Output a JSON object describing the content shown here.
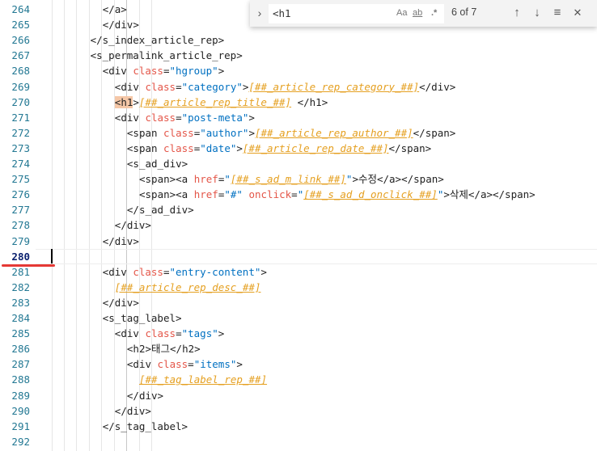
{
  "find_widget": {
    "toggle_icon": "›",
    "query": "<h1",
    "match_case_label": "Aa",
    "whole_word_label": "ab",
    "regex_label": ".*",
    "match_count": "6 of 7",
    "prev_icon": "↑",
    "next_icon": "↓",
    "selection_icon": "≡",
    "close_icon": "✕"
  },
  "editor": {
    "active_line": "280",
    "line_numbers": [
      "264",
      "265",
      "266",
      "267",
      "268",
      "269",
      "270",
      "271",
      "272",
      "273",
      "274",
      "275",
      "276",
      "277",
      "278",
      "279",
      "280",
      "281",
      "282",
      "283",
      "284",
      "285",
      "286",
      "287",
      "288",
      "289",
      "290",
      "291",
      "292"
    ],
    "lines": [
      [
        {
          "t": "</a>",
          "c": "tag"
        }
      ],
      [
        {
          "t": "</div>",
          "c": "tag"
        }
      ],
      [
        {
          "t": "</s_index_article_rep>",
          "c": "tag"
        }
      ],
      [
        {
          "t": "<s_permalink_article_rep>",
          "c": "tag"
        }
      ],
      [
        {
          "t": "<div ",
          "c": "tag"
        },
        {
          "t": "class",
          "c": "attr"
        },
        {
          "t": "=",
          "c": "tag"
        },
        {
          "t": "\"hgroup\"",
          "c": "str"
        },
        {
          "t": ">",
          "c": "tag"
        }
      ],
      [
        {
          "t": "<div ",
          "c": "tag"
        },
        {
          "t": "class",
          "c": "attr"
        },
        {
          "t": "=",
          "c": "tag"
        },
        {
          "t": "\"category\"",
          "c": "str"
        },
        {
          "t": ">",
          "c": "tag"
        },
        {
          "t": "[##_article_rep_category_##]",
          "c": "tpl"
        },
        {
          "t": "</div>",
          "c": "tag"
        }
      ],
      [
        {
          "t": "<h1",
          "c": "tag hl"
        },
        {
          "t": ">",
          "c": "tag"
        },
        {
          "t": "[##_article_rep_title_##]",
          "c": "tpl"
        },
        {
          "t": " </h1>",
          "c": "tag"
        }
      ],
      [
        {
          "t": "<div ",
          "c": "tag"
        },
        {
          "t": "class",
          "c": "attr"
        },
        {
          "t": "=",
          "c": "tag"
        },
        {
          "t": "\"post-meta\"",
          "c": "str"
        },
        {
          "t": ">",
          "c": "tag"
        }
      ],
      [
        {
          "t": "<span ",
          "c": "tag"
        },
        {
          "t": "class",
          "c": "attr"
        },
        {
          "t": "=",
          "c": "tag"
        },
        {
          "t": "\"author\"",
          "c": "str"
        },
        {
          "t": ">",
          "c": "tag"
        },
        {
          "t": "[##_article_rep_author_##]",
          "c": "tpl"
        },
        {
          "t": "</span>",
          "c": "tag"
        }
      ],
      [
        {
          "t": "<span ",
          "c": "tag"
        },
        {
          "t": "class",
          "c": "attr"
        },
        {
          "t": "=",
          "c": "tag"
        },
        {
          "t": "\"date\"",
          "c": "str"
        },
        {
          "t": ">",
          "c": "tag"
        },
        {
          "t": "[##_article_rep_date_##]",
          "c": "tpl"
        },
        {
          "t": "</span>",
          "c": "tag"
        }
      ],
      [
        {
          "t": "<s_ad_div>",
          "c": "tag"
        }
      ],
      [
        {
          "t": "<span><a ",
          "c": "tag"
        },
        {
          "t": "href",
          "c": "attr"
        },
        {
          "t": "=",
          "c": "tag"
        },
        {
          "t": "\"",
          "c": "str"
        },
        {
          "t": "[##_s_ad_m_link_##]",
          "c": "tpl"
        },
        {
          "t": "\"",
          "c": "str"
        },
        {
          "t": ">",
          "c": "tag"
        },
        {
          "t": "수정",
          "c": "tag kr"
        },
        {
          "t": "</a></span>",
          "c": "tag"
        }
      ],
      [
        {
          "t": "<span><a ",
          "c": "tag"
        },
        {
          "t": "href",
          "c": "attr"
        },
        {
          "t": "=",
          "c": "tag"
        },
        {
          "t": "\"#\" ",
          "c": "str"
        },
        {
          "t": "onclick",
          "c": "attr"
        },
        {
          "t": "=",
          "c": "tag"
        },
        {
          "t": "\"",
          "c": "str"
        },
        {
          "t": "[##_s_ad_d_onclick_##]",
          "c": "tpl"
        },
        {
          "t": "\"",
          "c": "str"
        },
        {
          "t": ">",
          "c": "tag"
        },
        {
          "t": "삭제",
          "c": "tag kr"
        },
        {
          "t": "</a></span>",
          "c": "tag"
        }
      ],
      [
        {
          "t": "</s_ad_div>",
          "c": "tag"
        }
      ],
      [
        {
          "t": "</div>",
          "c": "tag"
        }
      ],
      [
        {
          "t": "</div>",
          "c": "tag"
        }
      ],
      [],
      [
        {
          "t": "<div ",
          "c": "tag"
        },
        {
          "t": "class",
          "c": "attr"
        },
        {
          "t": "=",
          "c": "tag"
        },
        {
          "t": "\"entry-content\"",
          "c": "str"
        },
        {
          "t": ">",
          "c": "tag"
        }
      ],
      [
        {
          "t": "[##_article_rep_desc_##]",
          "c": "tpl"
        }
      ],
      [
        {
          "t": "</div>",
          "c": "tag"
        }
      ],
      [
        {
          "t": "<s_tag_label>",
          "c": "tag"
        }
      ],
      [
        {
          "t": "<div ",
          "c": "tag"
        },
        {
          "t": "class",
          "c": "attr"
        },
        {
          "t": "=",
          "c": "tag"
        },
        {
          "t": "\"tags\"",
          "c": "str"
        },
        {
          "t": ">",
          "c": "tag"
        }
      ],
      [
        {
          "t": "<h2>",
          "c": "tag"
        },
        {
          "t": "태그",
          "c": "tag kr"
        },
        {
          "t": "</h2>",
          "c": "tag"
        }
      ],
      [
        {
          "t": "<div ",
          "c": "tag"
        },
        {
          "t": "class",
          "c": "attr"
        },
        {
          "t": "=",
          "c": "tag"
        },
        {
          "t": "\"items\"",
          "c": "str"
        },
        {
          "t": ">",
          "c": "tag"
        }
      ],
      [
        {
          "t": "[##_tag_label_rep_##]",
          "c": "tpl"
        }
      ],
      [
        {
          "t": "</div>",
          "c": "tag"
        }
      ],
      [
        {
          "t": "</div>",
          "c": "tag"
        }
      ],
      [
        {
          "t": "</s_tag_label>",
          "c": "tag"
        }
      ],
      []
    ]
  }
}
